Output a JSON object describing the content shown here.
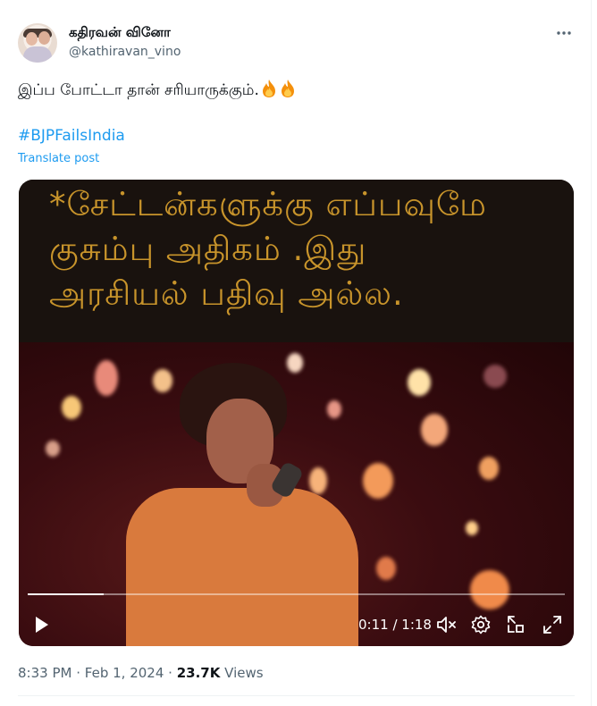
{
  "author": {
    "name": "கதிரவன் வினோ",
    "handle": "@kathiravan_vino"
  },
  "post": {
    "text": "இப்ப போட்டா தான் சரியாருக்கும்.",
    "emoji_icons": [
      "fire-icon",
      "fire-icon"
    ],
    "hashtag": "#BJPFailsIndia",
    "translate_label": "Translate post"
  },
  "video": {
    "caption_lines": [
      "*சேட்டன்களுக்கு எப்பவுமே",
      "குசும்பு அதிகம் .இது",
      "அரசியல் பதிவு அல்ல."
    ],
    "time_display": "0:11 / 1:18",
    "progress_fraction": 0.141,
    "controls": [
      "play-icon",
      "mute-icon",
      "settings-icon",
      "pip-icon",
      "fullscreen-icon"
    ]
  },
  "meta": {
    "time": "8:33 PM",
    "date": "Feb 1, 2024",
    "sep": "·",
    "views_count": "23.7K",
    "views_label": "Views"
  },
  "colors": {
    "link": "#1d9bf0",
    "secondary_text": "#536471",
    "caption_text": "#c8942b"
  }
}
